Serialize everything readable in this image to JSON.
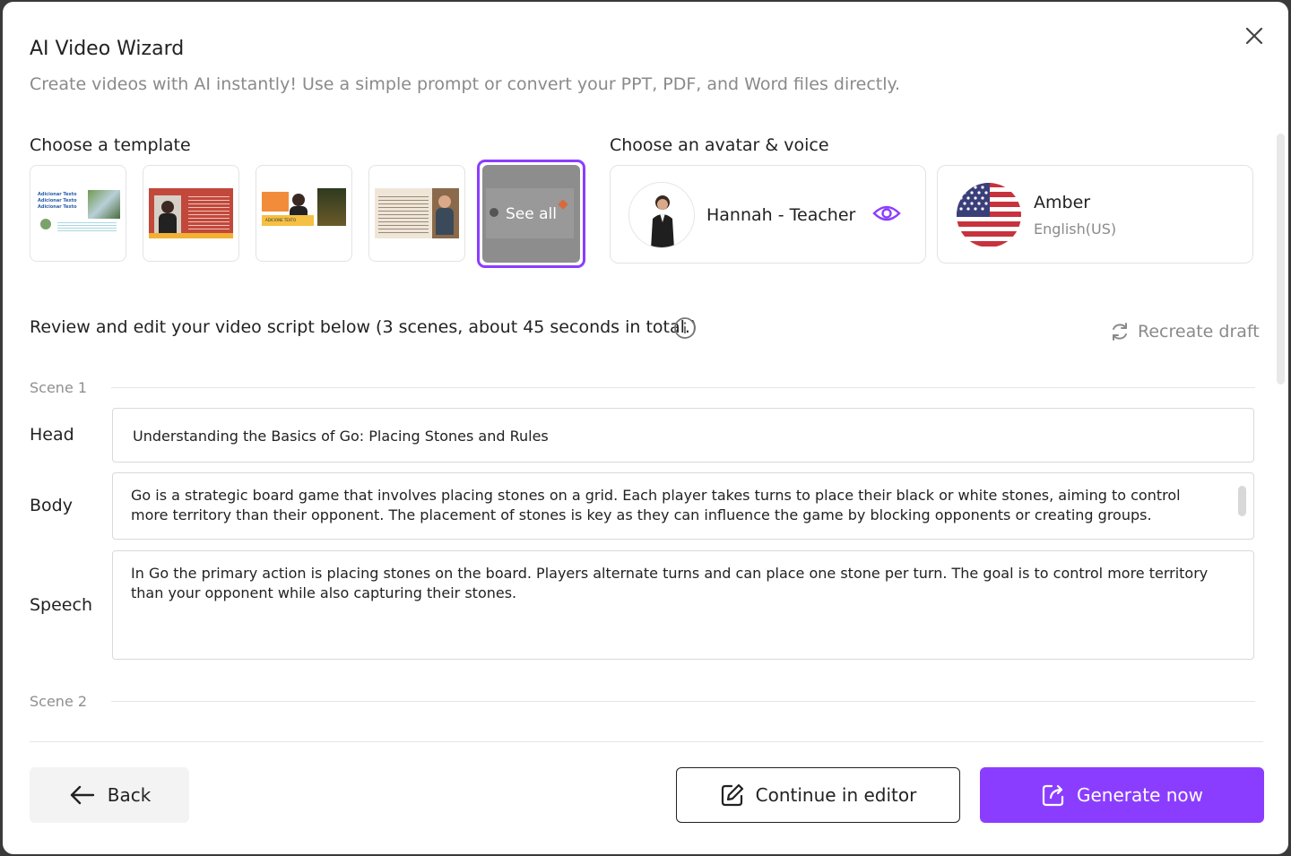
{
  "dialog": {
    "title": "AI Video Wizard",
    "subtitle": "Create videos with AI instantly! Use a simple prompt or convert your PPT, PDF, and Word files directly."
  },
  "templates": {
    "label": "Choose a template",
    "see_all_label": "See all",
    "thumb_texts": {
      "adicionar": "Adicionar Texto",
      "adicione": "ADICIONE TEXTO"
    }
  },
  "avatar_voice": {
    "label": "Choose an avatar & voice",
    "avatar_name": "Hannah - Teacher",
    "voice_name": "Amber",
    "voice_locale": "English(US)"
  },
  "script": {
    "review_text": "Review and edit your video script below (3 scenes, about 45 seconds in total.)",
    "recreate_label": "Recreate draft",
    "field_labels": {
      "head": "Head",
      "body": "Body",
      "speech": "Speech"
    },
    "scenes": [
      {
        "label": "Scene 1",
        "head": "Understanding the Basics of Go: Placing Stones and Rules",
        "body": "Go is a strategic board game that involves placing stones on a grid. Each player takes turns to place their black or white stones, aiming to control more territory than their opponent. The placement of stones is key as they can influence the game by blocking opponents or creating groups. Understanding",
        "speech": "In Go the primary action is placing stones on the board. Players alternate turns and can place one stone per turn. The goal is to control more territory than your opponent while also capturing their stones."
      },
      {
        "label": "Scene 2"
      }
    ]
  },
  "footer": {
    "back_label": "Back",
    "editor_label": "Continue in editor",
    "generate_label": "Generate now"
  },
  "colors": {
    "accent": "#8b3dff",
    "muted_text": "#8a8a8a"
  }
}
